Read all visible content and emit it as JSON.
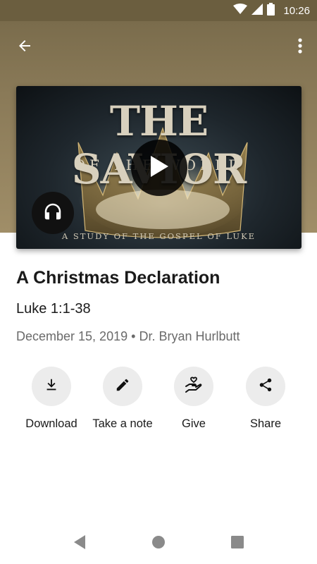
{
  "status_bar": {
    "time": "10:26",
    "icons": [
      "wifi-icon",
      "signal-icon",
      "battery-icon"
    ]
  },
  "header": {
    "icons": [
      "arrow-back-icon",
      "more-vert-icon"
    ]
  },
  "artwork": {
    "title": "THE SAVIOR",
    "subtitle": "OF THE WORLD",
    "caption": "A STUDY OF THE GOSPEL OF LUKE",
    "icons": [
      "crown-image",
      "play-icon",
      "headphones-icon"
    ]
  },
  "sermon": {
    "title": "A Christmas Declaration",
    "scripture": "Luke 1:1-38",
    "date": "December 15, 2019",
    "separator": "•",
    "speaker": "Dr. Bryan Hurlbutt"
  },
  "actions": [
    {
      "label": "Download",
      "icon": "download-icon"
    },
    {
      "label": "Take a note",
      "icon": "pencil-icon"
    },
    {
      "label": "Give",
      "icon": "give-heart-hand-icon"
    },
    {
      "label": "Share",
      "icon": "share-icon"
    }
  ],
  "nav": {
    "icons": [
      "nav-back-icon",
      "nav-home-icon",
      "nav-recents-icon"
    ]
  },
  "colors": {
    "header_band": "#8a7a58",
    "status_bar": "#6b5e3f",
    "action_circle": "#ececec",
    "meta_text": "#6a6a6a"
  }
}
